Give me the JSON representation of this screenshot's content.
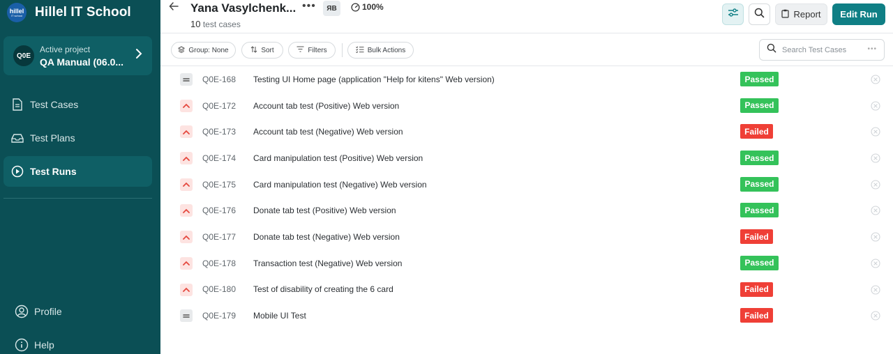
{
  "brand": {
    "logo_text": "hillel",
    "logo_sub": "IT school",
    "name": "Hillel IT School"
  },
  "project": {
    "label": "Active project",
    "name": "QA Manual (06.0...",
    "avatar": "Q0E"
  },
  "nav": {
    "test_cases": "Test Cases",
    "test_plans": "Test Plans",
    "test_runs": "Test Runs",
    "profile": "Profile",
    "help": "Help"
  },
  "header": {
    "title": "Yana Vasylchenk...",
    "more": "•••",
    "avatar": "ЯВ",
    "progress": "100%",
    "count": "10",
    "count_suffix": "test cases",
    "report_label": "Report",
    "edit_label": "Edit Run"
  },
  "toolbar": {
    "group_label": "Group: None",
    "sort_label": "Sort",
    "filters_label": "Filters",
    "bulk_label": "Bulk Actions",
    "search_placeholder": "Search Test Cases",
    "search_more": "•••"
  },
  "colors": {
    "sidebar": "#0b4f55",
    "primary": "#0f7f85",
    "passed": "#34c25a",
    "failed": "#ef3f36"
  },
  "cases": [
    {
      "id": "Q0E-168",
      "title": "Testing UI Home page (application \"Help for kitens\" Web version)",
      "priority": "normal",
      "status": "Passed"
    },
    {
      "id": "Q0E-172",
      "title": "Account tab test (Positive) Web version",
      "priority": "high",
      "status": "Passed"
    },
    {
      "id": "Q0E-173",
      "title": "Account tab test (Negative) Web version",
      "priority": "high",
      "status": "Failed"
    },
    {
      "id": "Q0E-174",
      "title": "Card manipulation test (Positive) Web version",
      "priority": "high",
      "status": "Passed"
    },
    {
      "id": "Q0E-175",
      "title": "Card manipulation test (Negative) Web version",
      "priority": "high",
      "status": "Passed"
    },
    {
      "id": "Q0E-176",
      "title": "Donate tab test (Positive) Web version",
      "priority": "high",
      "status": "Passed"
    },
    {
      "id": "Q0E-177",
      "title": "Donate tab test (Negative) Web version",
      "priority": "high",
      "status": "Failed"
    },
    {
      "id": "Q0E-178",
      "title": "Transaction test (Negative) Web version",
      "priority": "high",
      "status": "Passed"
    },
    {
      "id": "Q0E-180",
      "title": "Test of disability of creating the 6 card",
      "priority": "high",
      "status": "Failed"
    },
    {
      "id": "Q0E-179",
      "title": "Mobile UI Test",
      "priority": "normal",
      "status": "Failed"
    }
  ]
}
